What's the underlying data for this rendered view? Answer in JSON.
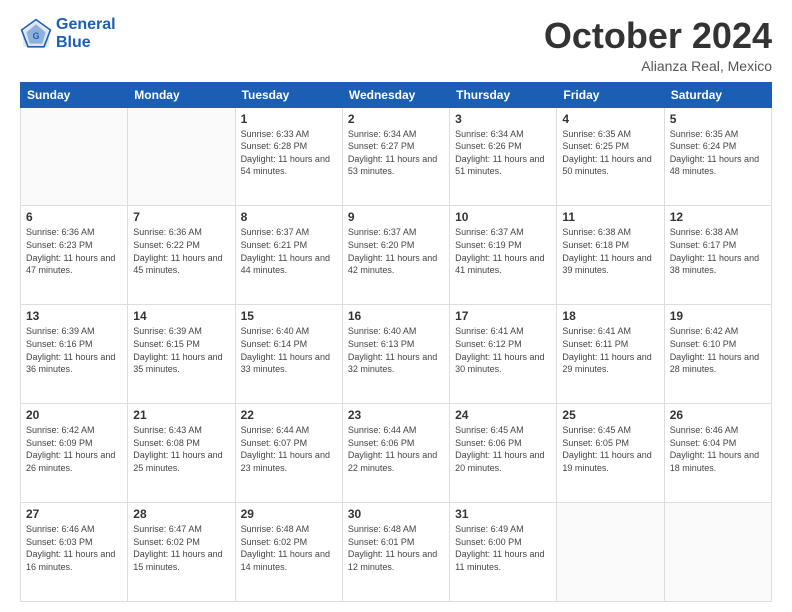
{
  "header": {
    "logo_line1": "General",
    "logo_line2": "Blue",
    "month": "October 2024",
    "location": "Alianza Real, Mexico"
  },
  "days_of_week": [
    "Sunday",
    "Monday",
    "Tuesday",
    "Wednesday",
    "Thursday",
    "Friday",
    "Saturday"
  ],
  "weeks": [
    [
      {
        "day": "",
        "info": ""
      },
      {
        "day": "",
        "info": ""
      },
      {
        "day": "1",
        "info": "Sunrise: 6:33 AM\nSunset: 6:28 PM\nDaylight: 11 hours and 54 minutes."
      },
      {
        "day": "2",
        "info": "Sunrise: 6:34 AM\nSunset: 6:27 PM\nDaylight: 11 hours and 53 minutes."
      },
      {
        "day": "3",
        "info": "Sunrise: 6:34 AM\nSunset: 6:26 PM\nDaylight: 11 hours and 51 minutes."
      },
      {
        "day": "4",
        "info": "Sunrise: 6:35 AM\nSunset: 6:25 PM\nDaylight: 11 hours and 50 minutes."
      },
      {
        "day": "5",
        "info": "Sunrise: 6:35 AM\nSunset: 6:24 PM\nDaylight: 11 hours and 48 minutes."
      }
    ],
    [
      {
        "day": "6",
        "info": "Sunrise: 6:36 AM\nSunset: 6:23 PM\nDaylight: 11 hours and 47 minutes."
      },
      {
        "day": "7",
        "info": "Sunrise: 6:36 AM\nSunset: 6:22 PM\nDaylight: 11 hours and 45 minutes."
      },
      {
        "day": "8",
        "info": "Sunrise: 6:37 AM\nSunset: 6:21 PM\nDaylight: 11 hours and 44 minutes."
      },
      {
        "day": "9",
        "info": "Sunrise: 6:37 AM\nSunset: 6:20 PM\nDaylight: 11 hours and 42 minutes."
      },
      {
        "day": "10",
        "info": "Sunrise: 6:37 AM\nSunset: 6:19 PM\nDaylight: 11 hours and 41 minutes."
      },
      {
        "day": "11",
        "info": "Sunrise: 6:38 AM\nSunset: 6:18 PM\nDaylight: 11 hours and 39 minutes."
      },
      {
        "day": "12",
        "info": "Sunrise: 6:38 AM\nSunset: 6:17 PM\nDaylight: 11 hours and 38 minutes."
      }
    ],
    [
      {
        "day": "13",
        "info": "Sunrise: 6:39 AM\nSunset: 6:16 PM\nDaylight: 11 hours and 36 minutes."
      },
      {
        "day": "14",
        "info": "Sunrise: 6:39 AM\nSunset: 6:15 PM\nDaylight: 11 hours and 35 minutes."
      },
      {
        "day": "15",
        "info": "Sunrise: 6:40 AM\nSunset: 6:14 PM\nDaylight: 11 hours and 33 minutes."
      },
      {
        "day": "16",
        "info": "Sunrise: 6:40 AM\nSunset: 6:13 PM\nDaylight: 11 hours and 32 minutes."
      },
      {
        "day": "17",
        "info": "Sunrise: 6:41 AM\nSunset: 6:12 PM\nDaylight: 11 hours and 30 minutes."
      },
      {
        "day": "18",
        "info": "Sunrise: 6:41 AM\nSunset: 6:11 PM\nDaylight: 11 hours and 29 minutes."
      },
      {
        "day": "19",
        "info": "Sunrise: 6:42 AM\nSunset: 6:10 PM\nDaylight: 11 hours and 28 minutes."
      }
    ],
    [
      {
        "day": "20",
        "info": "Sunrise: 6:42 AM\nSunset: 6:09 PM\nDaylight: 11 hours and 26 minutes."
      },
      {
        "day": "21",
        "info": "Sunrise: 6:43 AM\nSunset: 6:08 PM\nDaylight: 11 hours and 25 minutes."
      },
      {
        "day": "22",
        "info": "Sunrise: 6:44 AM\nSunset: 6:07 PM\nDaylight: 11 hours and 23 minutes."
      },
      {
        "day": "23",
        "info": "Sunrise: 6:44 AM\nSunset: 6:06 PM\nDaylight: 11 hours and 22 minutes."
      },
      {
        "day": "24",
        "info": "Sunrise: 6:45 AM\nSunset: 6:06 PM\nDaylight: 11 hours and 20 minutes."
      },
      {
        "day": "25",
        "info": "Sunrise: 6:45 AM\nSunset: 6:05 PM\nDaylight: 11 hours and 19 minutes."
      },
      {
        "day": "26",
        "info": "Sunrise: 6:46 AM\nSunset: 6:04 PM\nDaylight: 11 hours and 18 minutes."
      }
    ],
    [
      {
        "day": "27",
        "info": "Sunrise: 6:46 AM\nSunset: 6:03 PM\nDaylight: 11 hours and 16 minutes."
      },
      {
        "day": "28",
        "info": "Sunrise: 6:47 AM\nSunset: 6:02 PM\nDaylight: 11 hours and 15 minutes."
      },
      {
        "day": "29",
        "info": "Sunrise: 6:48 AM\nSunset: 6:02 PM\nDaylight: 11 hours and 14 minutes."
      },
      {
        "day": "30",
        "info": "Sunrise: 6:48 AM\nSunset: 6:01 PM\nDaylight: 11 hours and 12 minutes."
      },
      {
        "day": "31",
        "info": "Sunrise: 6:49 AM\nSunset: 6:00 PM\nDaylight: 11 hours and 11 minutes."
      },
      {
        "day": "",
        "info": ""
      },
      {
        "day": "",
        "info": ""
      }
    ]
  ]
}
